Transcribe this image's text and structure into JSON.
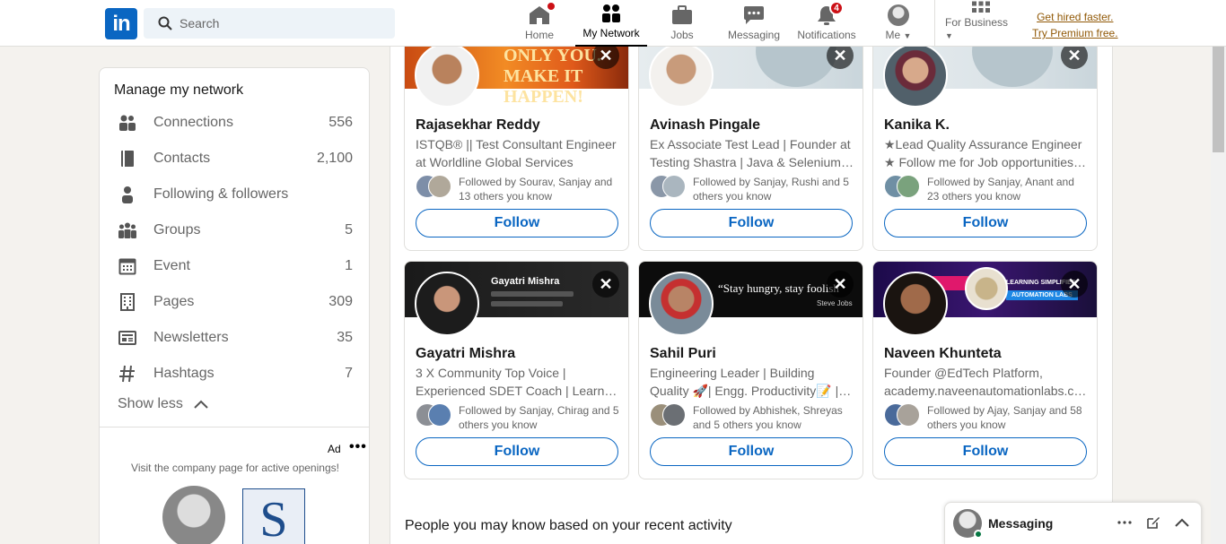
{
  "nav": {
    "logo": "in",
    "search_placeholder": "Search",
    "items": [
      {
        "label": "Home",
        "badge": ""
      },
      {
        "label": "My Network",
        "badge": ""
      },
      {
        "label": "Jobs",
        "badge": ""
      },
      {
        "label": "Messaging",
        "badge": ""
      },
      {
        "label": "Notifications",
        "badge": "4"
      },
      {
        "label": "Me",
        "badge": ""
      },
      {
        "label": "For Business",
        "badge": ""
      }
    ],
    "premium_line1": "Get hired faster.",
    "premium_line2": "Try Premium free."
  },
  "sidebar": {
    "title": "Manage my network",
    "items": [
      {
        "label": "Connections",
        "count": "556"
      },
      {
        "label": "Contacts",
        "count": "2,100"
      },
      {
        "label": "Following & followers",
        "count": ""
      },
      {
        "label": "Groups",
        "count": "5"
      },
      {
        "label": "Event",
        "count": "1"
      },
      {
        "label": "Pages",
        "count": "309"
      },
      {
        "label": "Newsletters",
        "count": "35"
      },
      {
        "label": "Hashtags",
        "count": "7"
      }
    ],
    "show_less": "Show less",
    "ad_label": "Ad",
    "ad_text": "Visit the company page for active openings!",
    "ad_logo_letter": "S"
  },
  "cards": [
    {
      "name": "Rajasekhar Reddy",
      "headline1": "ISTQB® || Test Consultant Engineer",
      "headline2": "at Worldline Global Services",
      "mutual1": "Followed by Sourav, Sanjay and",
      "mutual2": "13 others you know",
      "follow": "Follow",
      "banner_text": "ONLY YOU. MAKE IT HAPPEN!"
    },
    {
      "name": "Avinash Pingale",
      "headline1": "Ex Associate Test Lead | Founder at",
      "headline2": "Testing Shastra | Java & Selenium…",
      "mutual1": "Followed by Sanjay, Rushi and 5",
      "mutual2": "others you know",
      "follow": "Follow",
      "banner_text": ""
    },
    {
      "name": "Kanika K.",
      "headline1": "★Lead Quality Assurance Engineer",
      "headline2": "★ Follow me for Job opportunities…",
      "mutual1": "Followed by Sanjay, Anant and",
      "mutual2": "23 others you know",
      "follow": "Follow",
      "banner_text": ""
    },
    {
      "name": "Gayatri Mishra",
      "headline1": "3 X Community Top Voice |",
      "headline2": "Experienced SDET Coach | Learner …",
      "mutual1": "Followed by Sanjay, Chirag and 5",
      "mutual2": "others you know",
      "follow": "Follow",
      "banner_text": "Gayatri Mishra"
    },
    {
      "name": "Sahil Puri",
      "headline1": "Engineering Leader | Building",
      "headline2": "Quality 🚀| Engg. Productivity📝 |…",
      "mutual1": "Followed by Abhishek, Shreyas",
      "mutual2": "and 5 others you know",
      "follow": "Follow",
      "banner_text": "“Stay hungry, stay foolish",
      "banner_sub": "Steve Jobs"
    },
    {
      "name": "Naveen Khunteta",
      "headline1": "Founder @EdTech Platform,",
      "headline2": "academy.naveenautomationlabs.c…",
      "mutual1": "Followed by Ajay, Sanjay and 58",
      "mutual2": "others you know",
      "follow": "Follow",
      "banner_text": "AUTOMATION LABS",
      "banner_sub": "LEARNING SIMPLIFIED"
    }
  ],
  "section_title": "People you may know based on your recent activity",
  "messaging": {
    "title": "Messaging"
  },
  "colors": {
    "brand": "#0a66c2",
    "badge": "#cc1016",
    "premium": "#915907"
  }
}
